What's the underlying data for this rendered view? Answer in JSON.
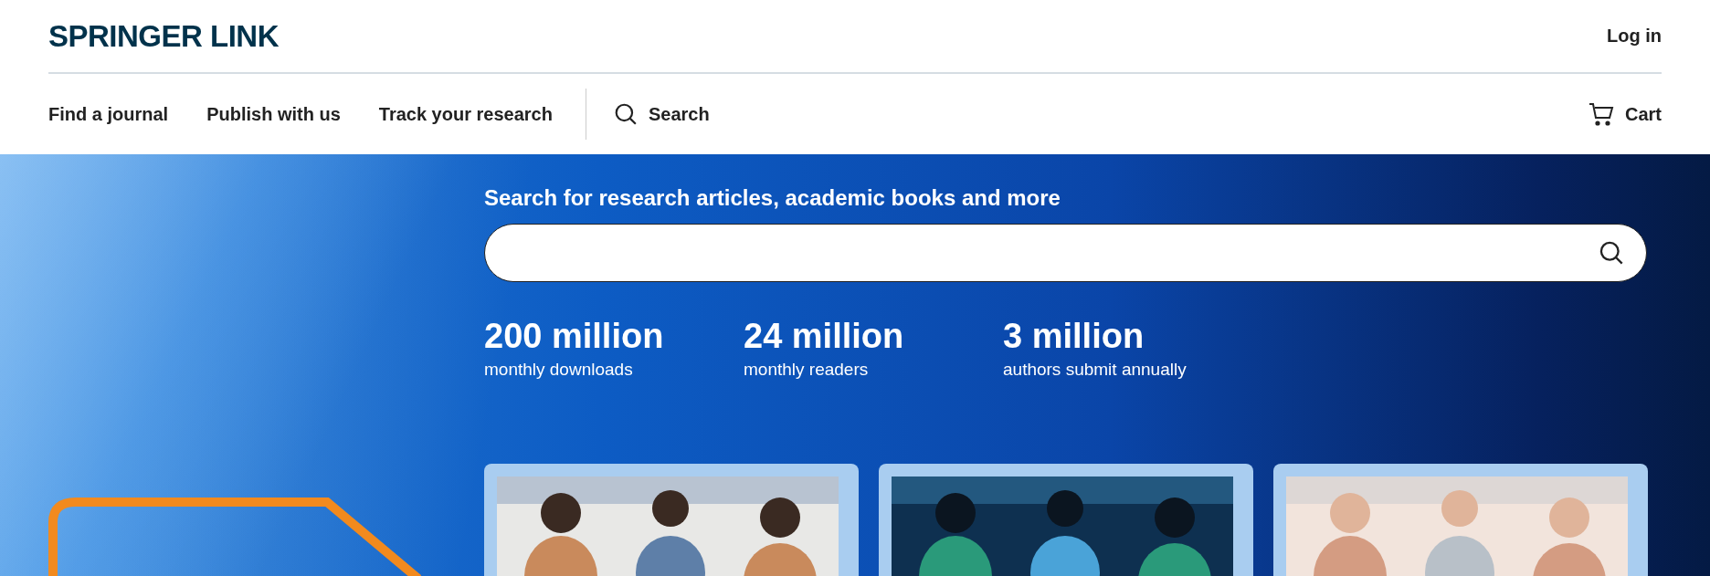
{
  "header": {
    "logo": "SPRINGER LINK",
    "login": "Log in"
  },
  "nav": {
    "items": [
      "Find a journal",
      "Publish with us",
      "Track your research"
    ],
    "search": "Search",
    "cart": "Cart"
  },
  "hero": {
    "search_label": "Search for research articles, academic books and more",
    "stats": [
      {
        "value": "200 million",
        "caption": "monthly downloads"
      },
      {
        "value": "24 million",
        "caption": "monthly readers"
      },
      {
        "value": "3 million",
        "caption": "authors submit annually"
      }
    ]
  }
}
